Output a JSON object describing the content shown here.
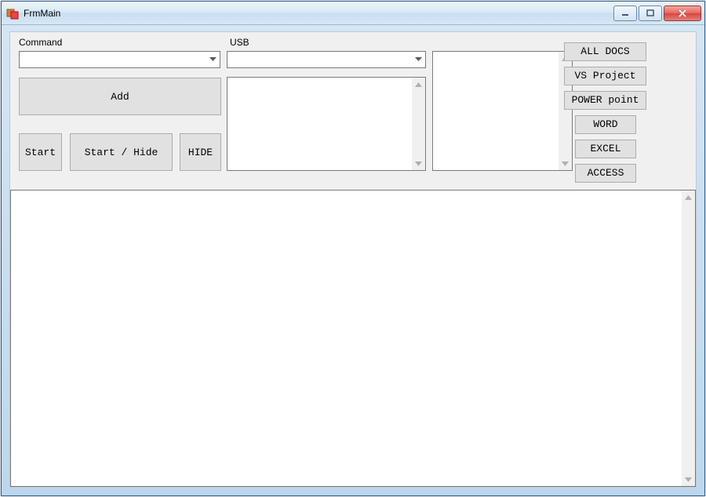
{
  "window": {
    "title": "FrmMain"
  },
  "labels": {
    "command": "Command",
    "usb": "USB"
  },
  "combos": {
    "command_value": "",
    "usb_value": ""
  },
  "buttons": {
    "add": "Add",
    "start": "Start",
    "start_hide": "Start / Hide",
    "hide": "HIDE"
  },
  "right_buttons": {
    "all_docs": "ALL DOCS",
    "vs_project": "VS Project",
    "power_point": "POWER point",
    "word": "WORD",
    "excel": "EXCEL",
    "access": "ACCESS"
  },
  "textareas": {
    "ta1": "",
    "ta2": "",
    "ta3": ""
  }
}
